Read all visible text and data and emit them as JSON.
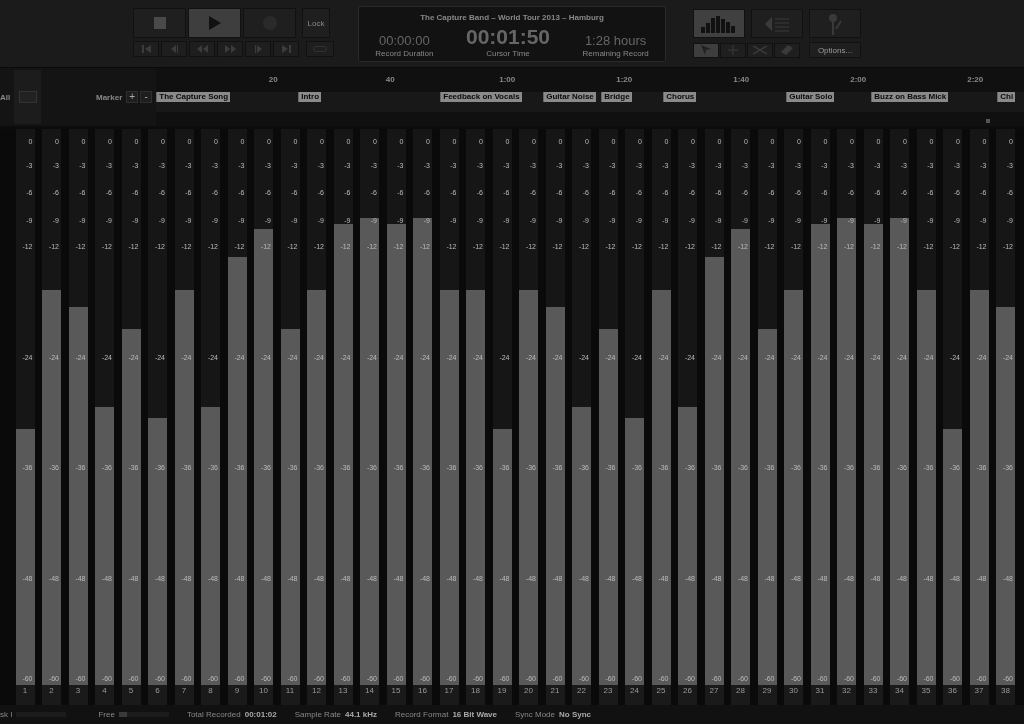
{
  "transport": {
    "buttons": [
      {
        "kind": "stop",
        "selected": false
      },
      {
        "kind": "play",
        "selected": true
      },
      {
        "kind": "record",
        "selected": false
      }
    ],
    "lock": "Lock",
    "nav": [
      {
        "kind": "start"
      },
      {
        "kind": "stepback"
      },
      {
        "kind": "rewind"
      },
      {
        "kind": "forward"
      },
      {
        "kind": "stepfwd"
      },
      {
        "kind": "end"
      },
      {
        "kind": "loop"
      }
    ]
  },
  "display": {
    "title": "The Capture Band – World Tour 2013 – Hamburg",
    "fields": [
      {
        "value": "00:00:00",
        "label": "Record Duration",
        "kind": "small"
      },
      {
        "value": "00:01:50",
        "label": "Cursor Time",
        "kind": "big"
      },
      {
        "value": "1:28 hours",
        "label": "Remaining Record",
        "kind": "small"
      }
    ]
  },
  "views": [
    {
      "kind": "meters",
      "selected": true
    },
    {
      "kind": "tracks",
      "selected": false
    },
    {
      "kind": "mic",
      "selected": false
    }
  ],
  "tools": [
    {
      "kind": "pointer",
      "selected": true
    },
    {
      "kind": "plus",
      "selected": false
    },
    {
      "kind": "scissors",
      "selected": false
    },
    {
      "kind": "eraser",
      "selected": false
    }
  ],
  "options": "Options...",
  "timeline": {
    "all": "All",
    "marker_label": "Marker",
    "add": "+",
    "remove": "-",
    "ticks": [
      "20",
      "40",
      "1:00",
      "1:20",
      "1:40",
      "2:00",
      "2:20"
    ],
    "markers": [
      "The Capture Song",
      "Intro",
      "Feedback on Vocals",
      "Guitar Noise",
      "Bridge",
      "Chorus",
      "Guitar Solo",
      "Buzz on Bass Mick",
      "Chi"
    ]
  },
  "channels": [
    {
      "number": "1",
      "level": 0.46,
      "scale": [
        "0",
        "-3",
        "-6",
        "-9",
        "-12",
        "-24",
        "-36",
        "-48",
        "-60"
      ]
    },
    {
      "number": "2",
      "level": 0.71,
      "scale": [
        "0",
        "-3",
        "-6",
        "-9",
        "-12",
        "-24",
        "-36",
        "-48",
        "-60"
      ]
    },
    {
      "number": "3",
      "level": 0.68,
      "scale": [
        "0",
        "-3",
        "-6",
        "-9",
        "-12",
        "-24",
        "-36",
        "-48",
        "-60"
      ]
    },
    {
      "number": "4",
      "level": 0.5,
      "scale": [
        "0",
        "-3",
        "-6",
        "-9",
        "-12",
        "-24",
        "-36",
        "-48",
        "-60"
      ]
    },
    {
      "number": "5",
      "level": 0.64,
      "scale": [
        "0",
        "-3",
        "-6",
        "-9",
        "-12",
        "-24",
        "-36",
        "-48",
        "-60"
      ]
    },
    {
      "number": "6",
      "level": 0.48,
      "scale": [
        "0",
        "-3",
        "-6",
        "-9",
        "-12",
        "-24",
        "-36",
        "-48",
        "-60"
      ]
    },
    {
      "number": "7",
      "level": 0.71,
      "scale": [
        "0",
        "-3",
        "-6",
        "-9",
        "-12",
        "-24",
        "-36",
        "-48",
        "-60"
      ]
    },
    {
      "number": "8",
      "level": 0.5,
      "scale": [
        "0",
        "-3",
        "-6",
        "-9",
        "-12",
        "-24",
        "-36",
        "-48",
        "-60"
      ]
    },
    {
      "number": "9",
      "level": 0.77,
      "scale": [
        "0",
        "-3",
        "-6",
        "-9",
        "-12",
        "-24",
        "-36",
        "-48",
        "-60"
      ]
    },
    {
      "number": "10",
      "level": 0.82,
      "scale": [
        "0",
        "-3",
        "-6",
        "-9",
        "-12",
        "-24",
        "-36",
        "-48",
        "-60"
      ]
    },
    {
      "number": "11",
      "level": 0.64,
      "scale": [
        "0",
        "-3",
        "-6",
        "-9",
        "-12",
        "-24",
        "-36",
        "-48",
        "-60"
      ]
    },
    {
      "number": "12",
      "level": 0.71,
      "scale": [
        "0",
        "-3",
        "-6",
        "-9",
        "-12",
        "-24",
        "-36",
        "-48",
        "-60"
      ]
    },
    {
      "number": "13",
      "level": 0.83,
      "scale": [
        "0",
        "-3",
        "-6",
        "-9",
        "-12",
        "-24",
        "-36",
        "-48",
        "-60"
      ]
    },
    {
      "number": "14",
      "level": 0.84,
      "scale": [
        "0",
        "-3",
        "-6",
        "-9",
        "-12",
        "-24",
        "-36",
        "-48",
        "-60"
      ]
    },
    {
      "number": "15",
      "level": 0.83,
      "scale": [
        "0",
        "-3",
        "-6",
        "-9",
        "-12",
        "-24",
        "-36",
        "-48",
        "-60"
      ]
    },
    {
      "number": "16",
      "level": 0.84,
      "scale": [
        "0",
        "-3",
        "-6",
        "-9",
        "-12",
        "-24",
        "-36",
        "-48",
        "-60"
      ]
    },
    {
      "number": "17",
      "level": 0.71,
      "scale": [
        "0",
        "-3",
        "-6",
        "-9",
        "-12",
        "-24",
        "-36",
        "-48",
        "-60"
      ]
    },
    {
      "number": "18",
      "level": 0.71,
      "scale": [
        "0",
        "-3",
        "-6",
        "-9",
        "-12",
        "-24",
        "-36",
        "-48",
        "-60"
      ]
    },
    {
      "number": "19",
      "level": 0.46,
      "scale": [
        "0",
        "-3",
        "-6",
        "-9",
        "-12",
        "-24",
        "-36",
        "-48",
        "-60"
      ]
    },
    {
      "number": "20",
      "level": 0.71,
      "scale": [
        "0",
        "-3",
        "-6",
        "-9",
        "-12",
        "-24",
        "-36",
        "-48",
        "-60"
      ]
    },
    {
      "number": "21",
      "level": 0.68,
      "scale": [
        "0",
        "-3",
        "-6",
        "-9",
        "-12",
        "-24",
        "-36",
        "-48",
        "-60"
      ]
    },
    {
      "number": "22",
      "level": 0.5,
      "scale": [
        "0",
        "-3",
        "-6",
        "-9",
        "-12",
        "-24",
        "-36",
        "-48",
        "-60"
      ]
    },
    {
      "number": "23",
      "level": 0.64,
      "scale": [
        "0",
        "-3",
        "-6",
        "-9",
        "-12",
        "-24",
        "-36",
        "-48",
        "-60"
      ]
    },
    {
      "number": "24",
      "level": 0.48,
      "scale": [
        "0",
        "-3",
        "-6",
        "-9",
        "-12",
        "-24",
        "-36",
        "-48",
        "-60"
      ]
    },
    {
      "number": "25",
      "level": 0.71,
      "scale": [
        "0",
        "-3",
        "-6",
        "-9",
        "-12",
        "-24",
        "-36",
        "-48",
        "-60"
      ]
    },
    {
      "number": "26",
      "level": 0.5,
      "scale": [
        "0",
        "-3",
        "-6",
        "-9",
        "-12",
        "-24",
        "-36",
        "-48",
        "-60"
      ]
    },
    {
      "number": "27",
      "level": 0.77,
      "scale": [
        "0",
        "-3",
        "-6",
        "-9",
        "-12",
        "-24",
        "-36",
        "-48",
        "-60"
      ]
    },
    {
      "number": "28",
      "level": 0.82,
      "scale": [
        "0",
        "-3",
        "-6",
        "-9",
        "-12",
        "-24",
        "-36",
        "-48",
        "-60"
      ]
    },
    {
      "number": "29",
      "level": 0.64,
      "scale": [
        "0",
        "-3",
        "-6",
        "-9",
        "-12",
        "-24",
        "-36",
        "-48",
        "-60"
      ]
    },
    {
      "number": "30",
      "level": 0.71,
      "scale": [
        "0",
        "-3",
        "-6",
        "-9",
        "-12",
        "-24",
        "-36",
        "-48",
        "-60"
      ]
    },
    {
      "number": "31",
      "level": 0.83,
      "scale": [
        "0",
        "-3",
        "-6",
        "-9",
        "-12",
        "-24",
        "-36",
        "-48",
        "-60"
      ]
    },
    {
      "number": "32",
      "level": 0.84,
      "scale": [
        "0",
        "-3",
        "-6",
        "-9",
        "-12",
        "-24",
        "-36",
        "-48",
        "-60"
      ]
    },
    {
      "number": "33",
      "level": 0.83,
      "scale": [
        "0",
        "-3",
        "-6",
        "-9",
        "-12",
        "-24",
        "-36",
        "-48",
        "-60"
      ]
    },
    {
      "number": "34",
      "level": 0.84,
      "scale": [
        "0",
        "-3",
        "-6",
        "-9",
        "-12",
        "-24",
        "-36",
        "-48",
        "-60"
      ]
    },
    {
      "number": "35",
      "level": 0.71,
      "scale": [
        "0",
        "-3",
        "-6",
        "-9",
        "-12",
        "-24",
        "-36",
        "-48",
        "-60"
      ]
    },
    {
      "number": "36",
      "level": 0.46,
      "scale": [
        "0",
        "-3",
        "-6",
        "-9",
        "-12",
        "-24",
        "-36",
        "-48",
        "-60"
      ]
    },
    {
      "number": "37",
      "level": 0.71,
      "scale": [
        "0",
        "-3",
        "-6",
        "-9",
        "-12",
        "-24",
        "-36",
        "-48",
        "-60"
      ]
    },
    {
      "number": "38",
      "level": 0.68,
      "scale": [
        "0",
        "-3",
        "-6",
        "-9",
        "-12",
        "-24",
        "-36",
        "-48",
        "-60"
      ]
    }
  ],
  "status_bar": {
    "disk": "sk I",
    "free": "Free",
    "items": [
      {
        "label": "Total Recorded",
        "value": "00:01:02"
      },
      {
        "label": "Sample Rate",
        "value": "44.1 kHz"
      },
      {
        "label": "Record Format",
        "value": "16 Bit Wave"
      },
      {
        "label": "Sync Mode",
        "value": "No Sync"
      }
    ]
  }
}
